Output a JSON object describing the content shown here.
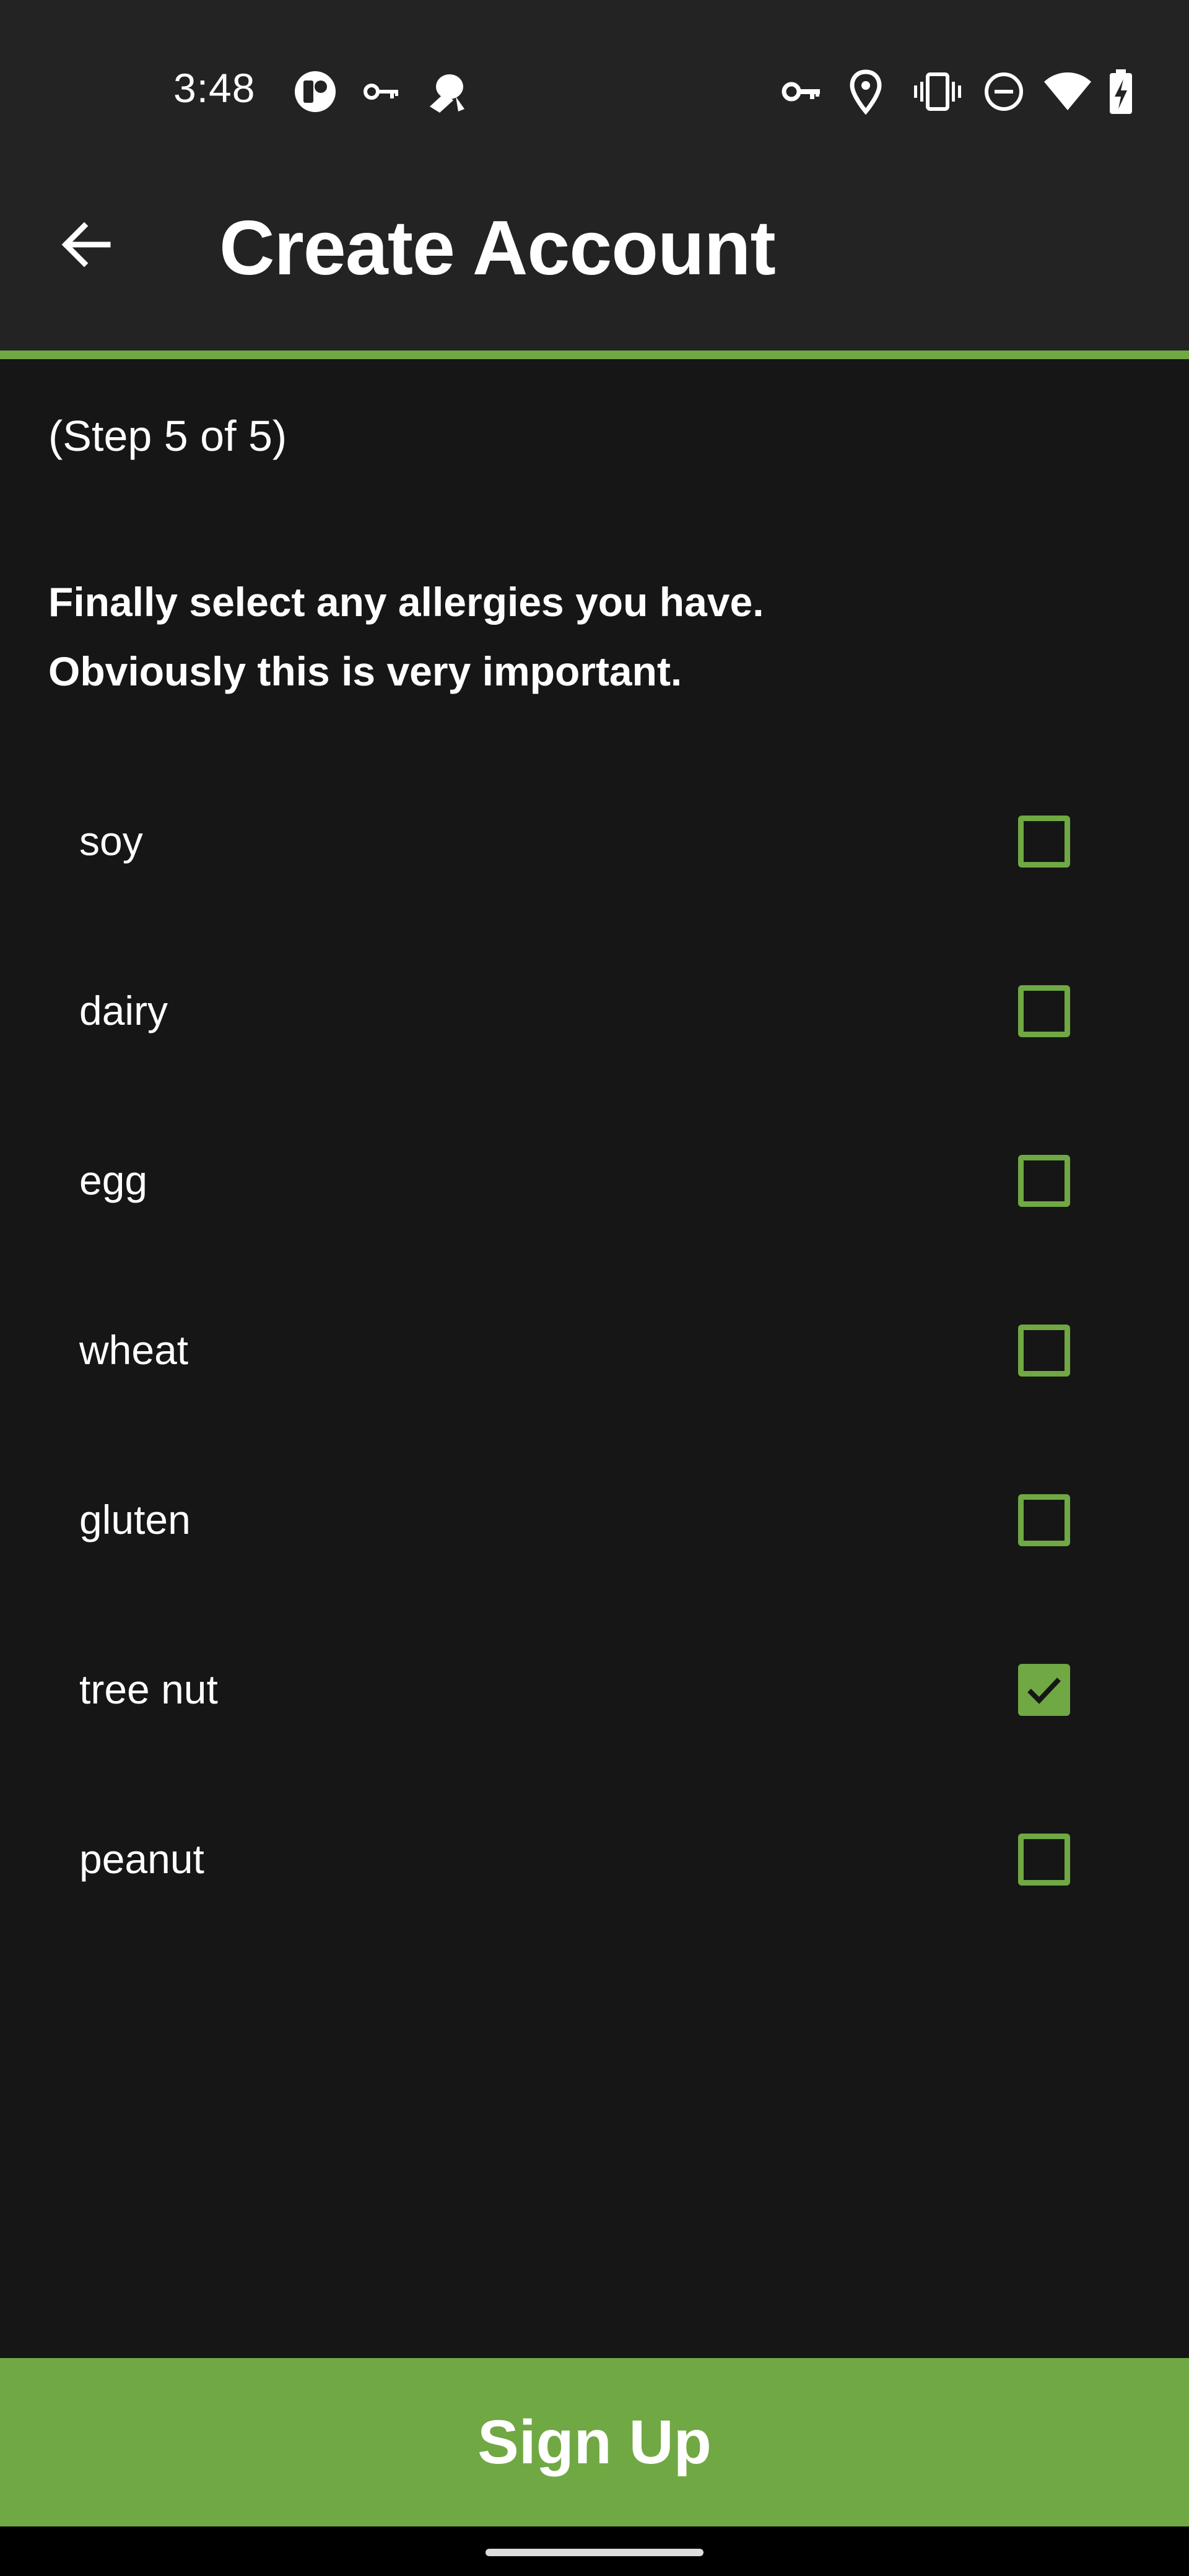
{
  "status_bar": {
    "time": "3:48",
    "left_icons": [
      "app-notification-icon",
      "vpn-key-icon",
      "bug-icon"
    ],
    "right_icons": [
      "vpn-key-icon",
      "location-pin-icon",
      "vibrate-icon",
      "do-not-disturb-icon",
      "wifi-icon",
      "battery-charging-icon"
    ]
  },
  "app_bar": {
    "back_icon": "back-arrow-icon",
    "title": "Create Account"
  },
  "step": {
    "label": "(Step 5 of 5)"
  },
  "intro": {
    "line1": "Finally select any allergies you have.",
    "line2": "Obviously this is very important."
  },
  "allergies": [
    {
      "label": "soy",
      "checked": false
    },
    {
      "label": "dairy",
      "checked": false
    },
    {
      "label": "egg",
      "checked": false
    },
    {
      "label": "wheat",
      "checked": false
    },
    {
      "label": "gluten",
      "checked": false
    },
    {
      "label": "tree nut",
      "checked": true
    },
    {
      "label": "peanut",
      "checked": false
    }
  ],
  "signup_button": {
    "label": "Sign Up"
  },
  "colors": {
    "accent": "#70a844",
    "app_bar": "#232323",
    "background": "#161616"
  }
}
